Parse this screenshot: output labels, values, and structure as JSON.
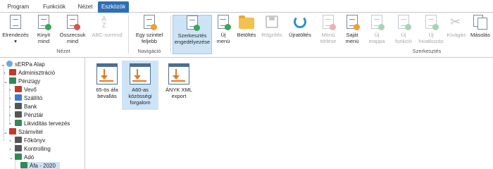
{
  "tabs": [
    {
      "label": "Program",
      "active": false
    },
    {
      "label": "Funkciók",
      "active": false
    },
    {
      "label": "Nézet",
      "active": false
    },
    {
      "label": "Eszközök",
      "active": true
    }
  ],
  "ribbon": {
    "groups": {
      "nezet": "Nézet",
      "navigacio": "Navigáció",
      "szerkesztes": "Szerkesztés"
    },
    "buttons": [
      {
        "label": "Elrendezés\n▾",
        "icon": "layout-icon",
        "enabled": true
      },
      {
        "label": "Kinyit\nmind",
        "icon": "expand-all-icon",
        "enabled": true
      },
      {
        "label": "Összecsuk\nmind",
        "icon": "collapse-all-icon",
        "enabled": true
      },
      {
        "label": "ABC-sorrend",
        "icon": "sort-az-icon",
        "enabled": false
      },
      {
        "label": "Egy szinttel\nfeljebb",
        "icon": "level-up-icon",
        "enabled": true
      },
      {
        "label": "Szerkesztés\nengedélyezése",
        "icon": "enable-edit-icon",
        "enabled": true,
        "selected": true
      },
      {
        "label": "Új\nmenü",
        "icon": "new-menu-icon",
        "enabled": true
      },
      {
        "label": "Betöltés",
        "icon": "folder-icon",
        "enabled": true
      },
      {
        "label": "Rögzítés",
        "icon": "save-icon",
        "enabled": false
      },
      {
        "label": "Újratöltés",
        "icon": "reload-icon",
        "enabled": true
      },
      {
        "label": "Menü\ntörlése",
        "icon": "delete-menu-icon",
        "enabled": false
      },
      {
        "label": "Saját\nmenü",
        "icon": "own-menu-icon",
        "enabled": true
      },
      {
        "label": "Új\nmappa",
        "icon": "new-folder-icon",
        "enabled": false
      },
      {
        "label": "Új\nfunkció",
        "icon": "new-function-icon",
        "enabled": false
      },
      {
        "label": "Új\nhivatkozás",
        "icon": "new-link-icon",
        "enabled": false
      },
      {
        "label": "Kivágás",
        "icon": "scissors-icon",
        "enabled": false
      },
      {
        "label": "Másolás",
        "icon": "copy-icon",
        "enabled": true
      }
    ]
  },
  "tree": {
    "root": "sERPa Alap",
    "items": [
      {
        "label": "Adminisztráció",
        "icon_color": "#c0392b"
      },
      {
        "label": "Pénzügy",
        "icon_color": "#2e8b57"
      },
      {
        "label": "Vevő",
        "icon_color": "#c0392b"
      },
      {
        "label": "Szállító",
        "icon_color": "#3a7bd5"
      },
      {
        "label": "Bank",
        "icon_color": "#555555"
      },
      {
        "label": "Pénztár",
        "icon_color": "#555555"
      },
      {
        "label": "Likviditás tervezés",
        "icon_color": "#2e8b57"
      },
      {
        "label": "Számvitel",
        "icon_color": "#c0392b"
      },
      {
        "label": "Főkönyv",
        "icon_color": "#555555"
      },
      {
        "label": "Kontrolling",
        "icon_color": "#555555"
      },
      {
        "label": "Adó",
        "icon_color": "#2e8b57"
      },
      {
        "label": "Áfa - 2020",
        "icon_color": "#2e8b57",
        "selected": true
      }
    ]
  },
  "content": {
    "items": [
      {
        "label": "65-ös áfa\nbevallás",
        "selected": false
      },
      {
        "label": "A60-as\nközösségi\nforgalom",
        "selected": true
      },
      {
        "label": "ÁNYK XML\nexport",
        "selected": false
      }
    ]
  }
}
